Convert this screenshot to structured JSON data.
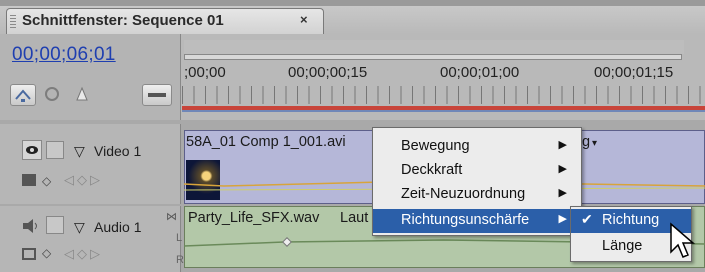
{
  "window": {
    "tab_title": "Schnittfenster: Sequence 01",
    "close_glyph": "×"
  },
  "timeline": {
    "timecode": "00;00;06;01",
    "ruler_labels": [
      ";00;00",
      "00;00;00;15",
      "00;00;01;00",
      "00;00;01;15"
    ]
  },
  "tracks": {
    "video": {
      "name": "Video 1",
      "clip_name": "58A_01 Comp 1_001.avi",
      "clip_tail": "g"
    },
    "audio": {
      "name": "Audio 1",
      "clip_name": "Party_Life_SFX.wav",
      "clip_suffix": "Laut",
      "channel_l": "L",
      "channel_r": "R"
    }
  },
  "context_menu": {
    "items": [
      {
        "label": "Bewegung",
        "submenu": true
      },
      {
        "label": "Deckkraft",
        "submenu": true
      },
      {
        "label": "Zeit-Neuzuordnung",
        "submenu": true
      },
      {
        "label": "Richtungsunschärfe",
        "submenu": true,
        "highlighted": true
      }
    ],
    "submenu_items": [
      {
        "label": "Richtung",
        "checked": true,
        "highlighted": true
      },
      {
        "label": "Länge",
        "checked": false
      }
    ]
  },
  "colors": {
    "timecode": "#1f3fb0",
    "menu_highlight": "#2b5fa9",
    "video_clip": "#b5b7d8",
    "audio_clip": "#b3c8a8",
    "ruler_red": "#c8443a"
  },
  "icons": [
    "grip-icon",
    "close-icon",
    "snap-icon",
    "marker-icon",
    "keyframe-icon",
    "eye-icon",
    "speaker-icon",
    "triangle-down-icon",
    "submenu-arrow-icon",
    "checkmark-icon",
    "mouse-cursor-icon"
  ]
}
